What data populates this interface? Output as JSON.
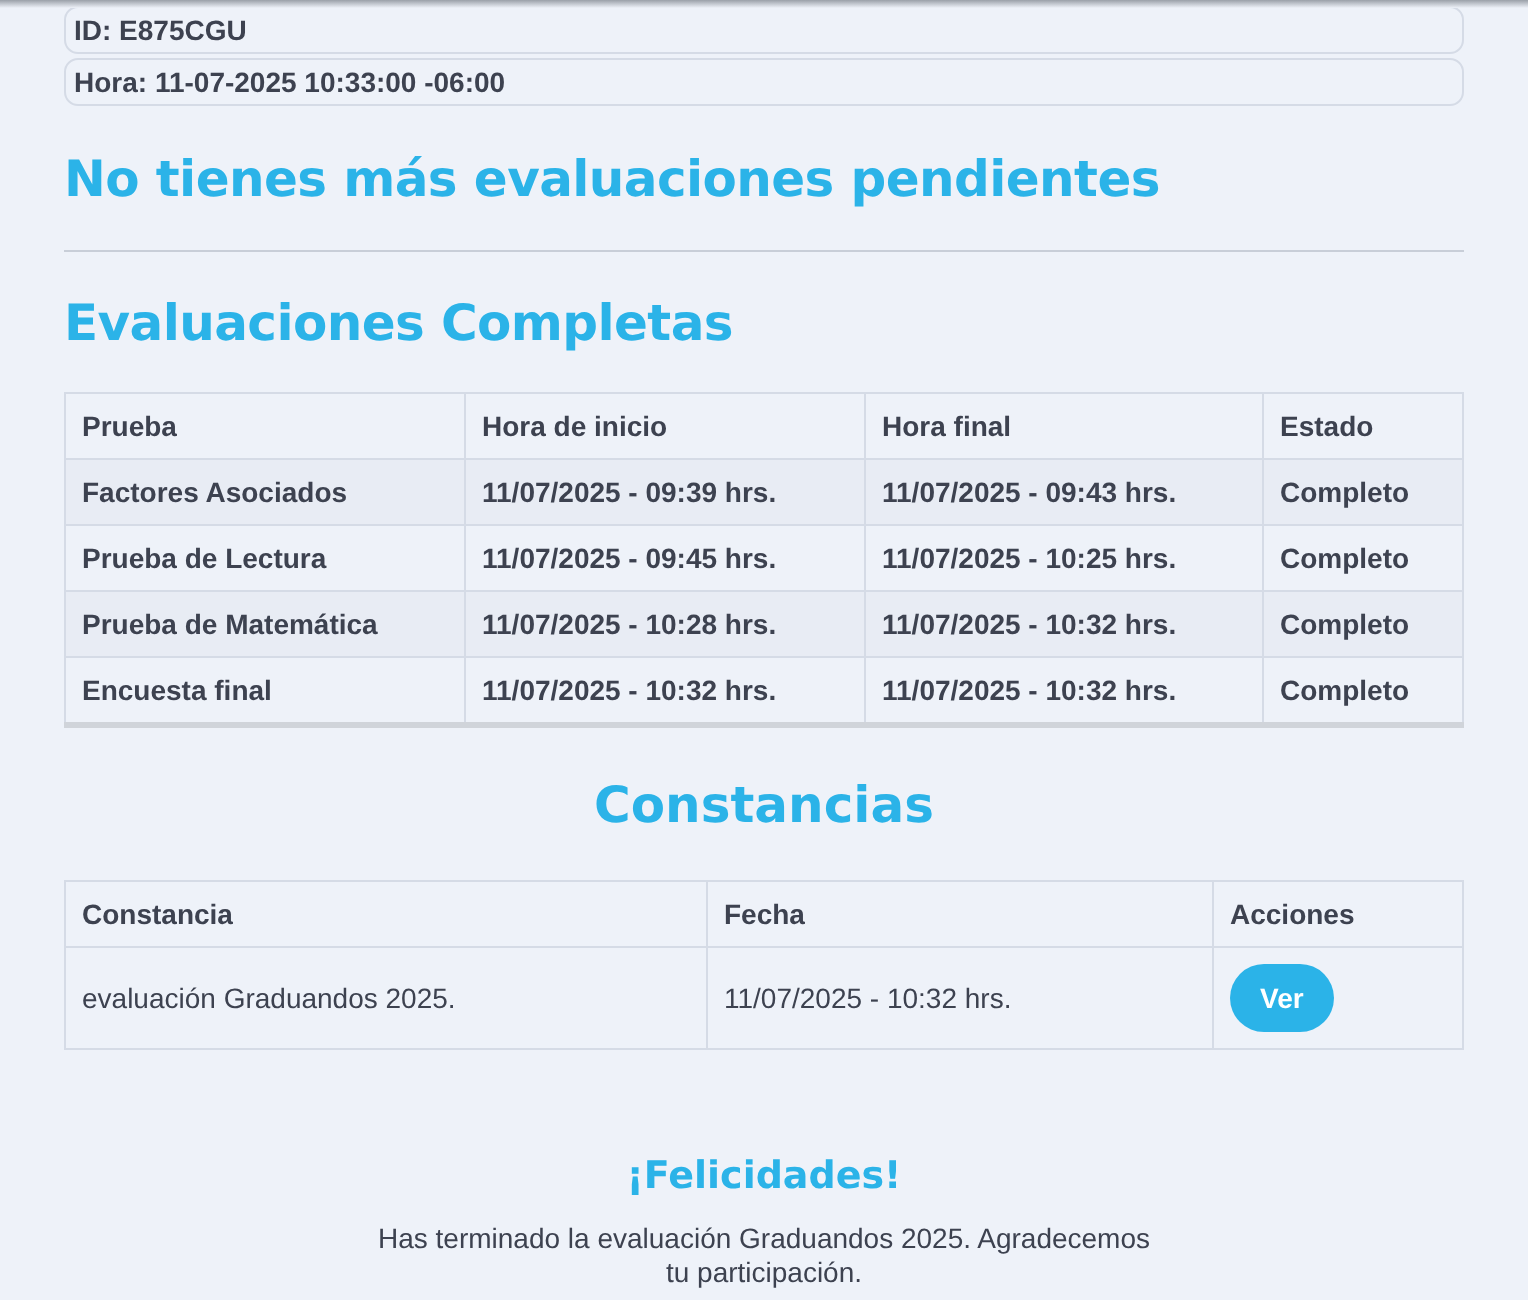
{
  "info": [
    "ID: E875CGU",
    "Hora: 11-07-2025 10:33:00 -06:00"
  ],
  "pending_heading": "No tienes más evaluaciones pendientes",
  "completed": {
    "heading": "Evaluaciones Completas",
    "columns": [
      "Prueba",
      "Hora de inicio",
      "Hora final",
      "Estado"
    ],
    "rows": [
      [
        "Factores Asociados",
        "11/07/2025 - 09:39 hrs.",
        "11/07/2025 - 09:43 hrs.",
        "Completo"
      ],
      [
        "Prueba de Lectura",
        "11/07/2025 - 09:45 hrs.",
        "11/07/2025 - 10:25 hrs.",
        "Completo"
      ],
      [
        "Prueba de Matemática",
        "11/07/2025 - 10:28 hrs.",
        "11/07/2025 - 10:32 hrs.",
        "Completo"
      ],
      [
        "Encuesta final",
        "11/07/2025 - 10:32 hrs.",
        "11/07/2025 - 10:32 hrs.",
        "Completo"
      ]
    ]
  },
  "certificates": {
    "heading": "Constancias",
    "columns": [
      "Constancia",
      "Fecha",
      "Acciones"
    ],
    "rows": [
      {
        "name": "evaluación Graduandos 2025.",
        "date": "11/07/2025 - 10:32 hrs.",
        "action": "Ver"
      }
    ]
  },
  "congrats": {
    "title": "¡Felicidades!",
    "message": "Has terminado la evaluación Graduandos 2025. Agradecemos tu participación."
  }
}
